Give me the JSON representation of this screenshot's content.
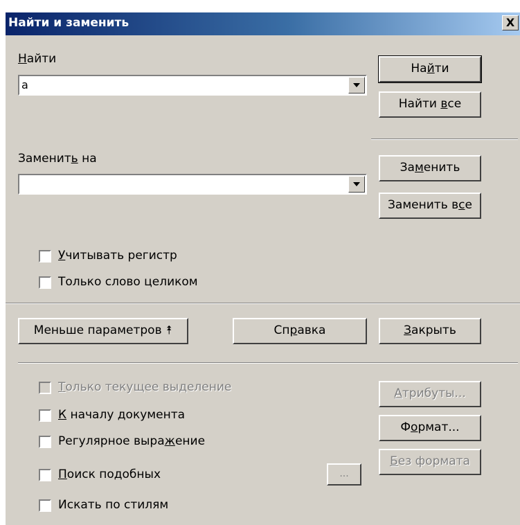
{
  "window": {
    "title": "Найти и заменить",
    "close_label": "X"
  },
  "find": {
    "label_u": "Н",
    "label_rest": "айти",
    "value": "a"
  },
  "replace": {
    "label_pre": "Заменит",
    "label_u": "ь",
    "label_post": " на",
    "value": ""
  },
  "buttons": {
    "find": {
      "pre": "На",
      "u": "й",
      "post": "ти"
    },
    "find_all": {
      "pre": "Найти ",
      "u": "в",
      "post": "се"
    },
    "replace": {
      "pre": "За",
      "u": "м",
      "post": "енить"
    },
    "replace_all": {
      "pre": "Заменить в",
      "u": "с",
      "post": "е"
    },
    "fewer_options": "Меньше параметров ⯭",
    "help": {
      "pre": "Сп",
      "u": "р",
      "post": "авка"
    },
    "close": {
      "pre": "",
      "u": "З",
      "post": "акрыть"
    },
    "attributes": {
      "pre": "",
      "u": "А",
      "post": "трибуты..."
    },
    "format": {
      "pre": "Ф",
      "u": "о",
      "post": "рмат..."
    },
    "no_format": {
      "pre": "",
      "u": "Б",
      "post": "ез формата"
    },
    "similarity_ellipsis": "..."
  },
  "options": {
    "match_case": {
      "u": "У",
      "rest": "читывать регистр",
      "checked": false
    },
    "whole_words": {
      "u": "",
      "rest": "Только слово целиком",
      "checked": false
    },
    "current_selection": {
      "u": "Т",
      "rest": "олько текущее выделение",
      "checked": false,
      "disabled": true
    },
    "backwards": {
      "u": "К",
      "rest": " началу документа",
      "checked": false
    },
    "regex": {
      "pre": "Регулярное выра",
      "u": "ж",
      "post": "ение",
      "checked": false
    },
    "similarity": {
      "u": "П",
      "rest": "оиск подобных",
      "checked": false
    },
    "styles": {
      "u": "",
      "rest": "Искать по стилям",
      "checked": false
    }
  }
}
